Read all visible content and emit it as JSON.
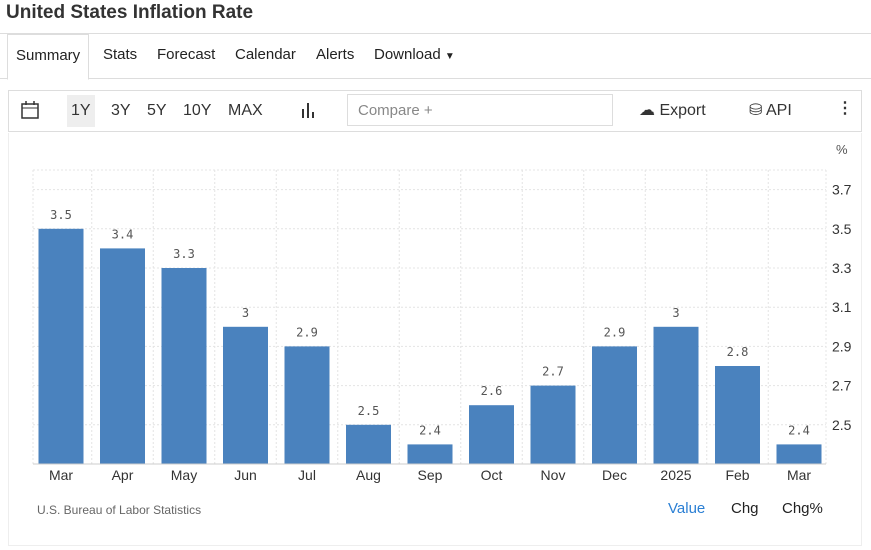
{
  "title": "United States Inflation Rate",
  "tabs": [
    "Summary",
    "Stats",
    "Forecast",
    "Calendar",
    "Alerts",
    "Download"
  ],
  "toolbar": {
    "ranges": [
      "1Y",
      "3Y",
      "5Y",
      "10Y",
      "MAX"
    ],
    "compare_placeholder": "Compare +",
    "export": "Export",
    "api": "API"
  },
  "source": "U.S. Bureau of Labor Statistics",
  "view_toggle": {
    "value": "Value",
    "chg": "Chg",
    "chgpct": "Chg%"
  },
  "colors": {
    "bar": "#4a82be",
    "active_link": "#2a7fd4"
  },
  "chart_data": {
    "type": "bar",
    "categories": [
      "Mar",
      "Apr",
      "May",
      "Jun",
      "Jul",
      "Aug",
      "Sep",
      "Oct",
      "Nov",
      "Dec",
      "2025",
      "Feb",
      "Mar"
    ],
    "values": [
      3.5,
      3.4,
      3.3,
      3.0,
      2.9,
      2.5,
      2.4,
      2.6,
      2.7,
      2.9,
      3.0,
      2.8,
      2.4
    ],
    "labels": [
      "3.5",
      "3.4",
      "3.3",
      "3",
      "2.9",
      "2.5",
      "2.4",
      "2.6",
      "2.7",
      "2.9",
      "3",
      "2.8",
      "2.4"
    ],
    "unit": "%",
    "yticks": [
      2.5,
      2.7,
      2.9,
      3.1,
      3.3,
      3.5,
      3.7
    ],
    "ytick_labels": [
      "2.5",
      "2.7",
      "2.9",
      "3.1",
      "3.3",
      "3.5",
      "3.7"
    ],
    "ylim": [
      2.3,
      3.8
    ],
    "grid": true
  }
}
